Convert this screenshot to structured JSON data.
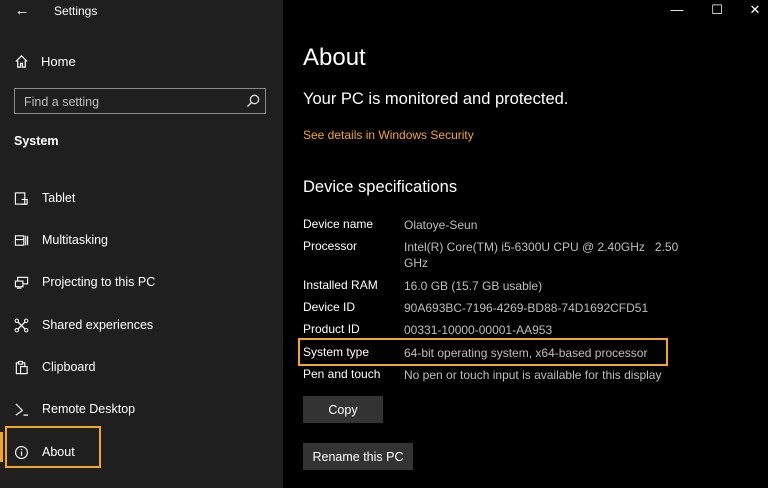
{
  "window": {
    "title": "Settings",
    "controls": {
      "minimize": "—",
      "maximize": "☐",
      "close": "✕"
    }
  },
  "sidebar": {
    "back_icon": "arrow-left-icon",
    "home_label": "Home",
    "search_placeholder": "Find a setting",
    "section": "System",
    "items": [
      {
        "label": "Tablet",
        "icon": "tablet-icon"
      },
      {
        "label": "Multitasking",
        "icon": "multitasking-icon"
      },
      {
        "label": "Projecting to this PC",
        "icon": "projecting-icon"
      },
      {
        "label": "Shared experiences",
        "icon": "shared-experiences-icon"
      },
      {
        "label": "Clipboard",
        "icon": "clipboard-icon"
      },
      {
        "label": "Remote Desktop",
        "icon": "remote-desktop-icon"
      },
      {
        "label": "About",
        "icon": "info-icon",
        "selected": true
      }
    ],
    "accent_color": "#f2a81d"
  },
  "main": {
    "title": "About",
    "protection_status": "Your PC is monitored and protected.",
    "security_link": "See details in Windows Security",
    "specs_heading": "Device specifications",
    "specs": [
      {
        "label": "Device name",
        "value": "Olatoye-Seun"
      },
      {
        "label": "Processor",
        "value": "Intel(R) Core(TM) i5-6300U CPU @ 2.40GHz   2.50 GHz"
      },
      {
        "label": "Installed RAM",
        "value": "16.0 GB (15.7 GB usable)"
      },
      {
        "label": "Device ID",
        "value": "90A693BC-7196-4269-BD88-74D1692CFD51"
      },
      {
        "label": "Product ID",
        "value": "00331-10000-00001-AA953"
      },
      {
        "label": "System type",
        "value": "64-bit operating system, x64-based processor",
        "highlighted": true
      },
      {
        "label": "Pen and touch",
        "value": "No pen or touch input is available for this display"
      }
    ],
    "copy_button": "Copy",
    "rename_button": "Rename this PC",
    "link_color": "#f5a623"
  }
}
